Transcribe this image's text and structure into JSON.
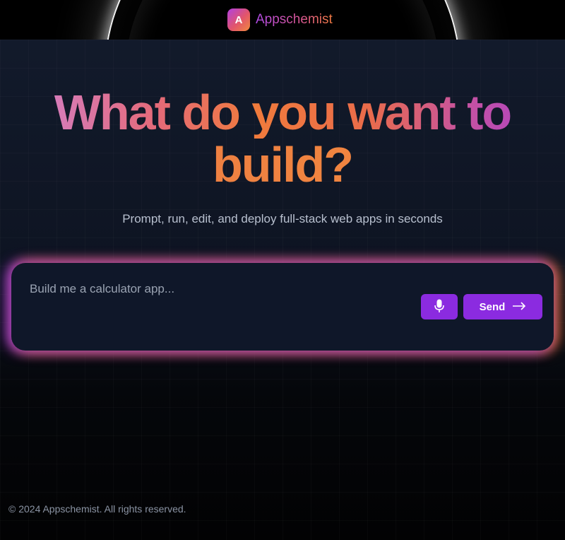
{
  "header": {
    "logo_letter": "A",
    "brand_name": "Appschemist"
  },
  "hero": {
    "title_line1": "What do you want to",
    "title_line2": "build?",
    "subtitle": "Prompt, run, edit, and deploy full-stack web apps in seconds"
  },
  "prompt": {
    "placeholder": "Build me a calculator app...",
    "value": "",
    "send_label": "Send"
  },
  "icons": {
    "mic": "microphone-icon",
    "send": "arrow-right-icon"
  },
  "colors": {
    "accent": "#8b2be0",
    "brand_gradient_start": "#b04be6",
    "brand_gradient_end": "#f07a40"
  },
  "footer": {
    "copyright": "© 2024 Appschemist. All rights reserved."
  }
}
